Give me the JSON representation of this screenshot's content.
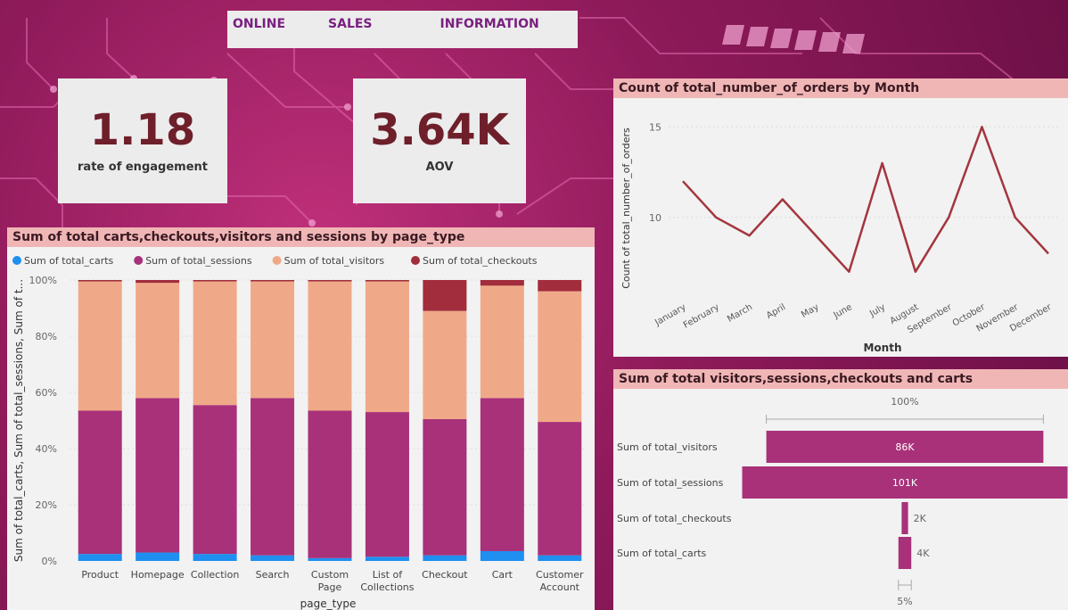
{
  "nav": {
    "items": [
      "ONLINE",
      "SALES",
      "INFORMATION"
    ]
  },
  "kpis": {
    "engagement": {
      "value": "1.18",
      "label": "rate of engagement"
    },
    "aov": {
      "value": "3.64K",
      "label": "AOV"
    }
  },
  "colors": {
    "carts": "#1f8ff0",
    "sessions": "#a8317a",
    "visitors": "#f0a988",
    "checkouts": "#a22d3c",
    "line": "#a3363e",
    "funnel": "#a8317a",
    "title_bg": "#f0b6b6"
  },
  "chart_data": [
    {
      "type": "bar",
      "stacked": "100%",
      "title": "Sum of total carts,checkouts,visitors and sessions by page_type",
      "xlabel": "page_type",
      "ylabel": "Sum of total_carts, Sum of total_sessions, Sum of t...",
      "legend_position": "top-left",
      "yticks": [
        "0%",
        "20%",
        "40%",
        "60%",
        "80%",
        "100%"
      ],
      "categories": [
        "Product",
        "Homepage",
        "Collection",
        "Search",
        "Custom Page",
        "List of Collections",
        "Checkout",
        "Cart",
        "Customer Account"
      ],
      "series": [
        {
          "name": "Sum of total_carts",
          "key": "carts",
          "values": [
            2.5,
            3,
            2.5,
            2,
            1,
            1.5,
            2,
            3.5,
            2
          ]
        },
        {
          "name": "Sum of total_sessions",
          "key": "sessions",
          "values": [
            51,
            55,
            53,
            56,
            52.5,
            51.5,
            48.5,
            54.5,
            47.5
          ]
        },
        {
          "name": "Sum of total_visitors",
          "key": "visitors",
          "values": [
            46,
            41,
            44,
            41.5,
            46,
            46.5,
            38.5,
            40,
            46.5
          ]
        },
        {
          "name": "Sum of total_checkouts",
          "key": "checkouts",
          "values": [
            0.5,
            1,
            0.5,
            0.5,
            0.5,
            0.5,
            11,
            2,
            4
          ]
        }
      ]
    },
    {
      "type": "line",
      "title": "Count of total_number_of_orders by Month",
      "xlabel": "Month",
      "ylabel": "Count of total_number_of_orders",
      "yticks": [
        10,
        15
      ],
      "ylim": [
        6,
        16
      ],
      "categories": [
        "January",
        "February",
        "March",
        "April",
        "May",
        "June",
        "July",
        "August",
        "September",
        "October",
        "November",
        "December"
      ],
      "values": [
        12,
        10,
        9,
        11,
        9,
        7,
        13,
        7,
        10,
        15,
        10,
        8
      ]
    },
    {
      "type": "bar",
      "subtype": "funnel",
      "title": "Sum of total visitors,sessions,checkouts and carts",
      "top_label": "100%",
      "bottom_label": "5%",
      "categories": [
        "Sum of total_visitors",
        "Sum of total_sessions",
        "Sum of total_checkouts",
        "Sum of total_carts"
      ],
      "values": [
        86,
        101,
        2,
        4
      ],
      "value_labels": [
        "86K",
        "101K",
        "2K",
        "4K"
      ]
    }
  ]
}
